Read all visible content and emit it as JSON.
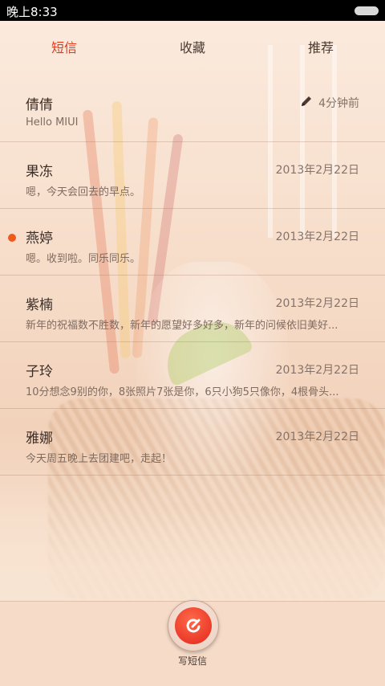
{
  "status_bar": {
    "time": "晚上8:33"
  },
  "tabs": [
    {
      "label": "短信",
      "active": true
    },
    {
      "label": "收藏",
      "active": false
    },
    {
      "label": "推荐",
      "active": false
    }
  ],
  "conversations": [
    {
      "name": "倩倩",
      "snippet": "Hello MIUI",
      "date": "4分钟前",
      "draft_icon": "pencil-icon",
      "unread": false
    },
    {
      "name": "果冻",
      "snippet": "嗯，今天会回去的早点。",
      "date": "2013年2月22日",
      "unread": false
    },
    {
      "name": "燕婷",
      "snippet": "嗯。收到啦。同乐同乐。",
      "date": "2013年2月22日",
      "unread": true
    },
    {
      "name": "紫楠",
      "snippet": "新年的祝福数不胜数，新年的愿望好多好多，新年的问候依旧美好...",
      "date": "2013年2月22日",
      "unread": false
    },
    {
      "name": "子玲",
      "snippet": "10分想念9别的你，8张照片7张是你，6只小狗5只像你，4根骨头...",
      "date": "2013年2月22日",
      "unread": false
    },
    {
      "name": "雅娜",
      "snippet": "今天周五晚上去团建吧，走起！",
      "date": "2013年2月22日",
      "unread": false
    }
  ],
  "compose": {
    "label": "写短信",
    "icon": "compose-icon"
  },
  "colors": {
    "accent": "#e33a1d",
    "unread_dot": "#ee5a1c"
  }
}
